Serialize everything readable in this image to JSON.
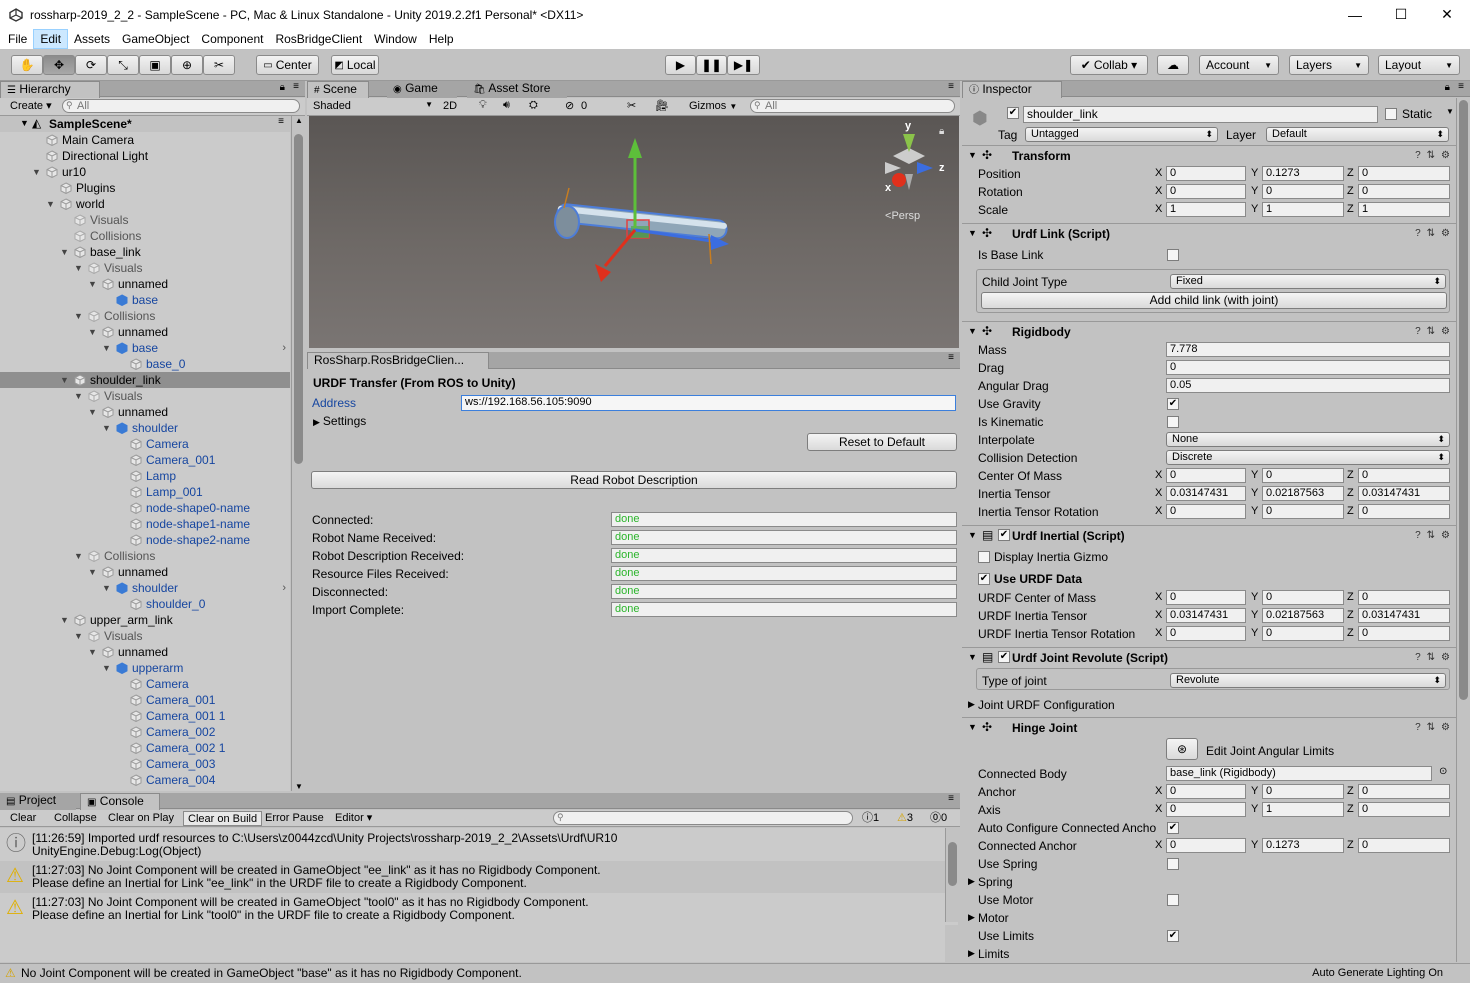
{
  "window": {
    "title": "rossharp-2019_2_2 - SampleScene - PC, Mac & Linux Standalone - Unity 2019.2.2f1 Personal* <DX11>",
    "minimize": "—",
    "maximize": "☐",
    "close": "✕"
  },
  "menu": [
    "File",
    "Edit",
    "Assets",
    "GameObject",
    "Component",
    "RosBridgeClient",
    "Window",
    "Help"
  ],
  "toolbar": {
    "center": "Center",
    "local": "Local",
    "collab": "Collab ▾",
    "account": "Account",
    "layers": "Layers",
    "layout": "Layout"
  },
  "hierarchy": {
    "tab": "Hierarchy",
    "create": "Create ▾",
    "search_placeholder": "All",
    "scene": "SampleScene*",
    "items": [
      {
        "label": "Main Camera",
        "style": "normal"
      },
      {
        "label": "Directional Light",
        "style": "normal"
      },
      {
        "label": "ur10",
        "style": "normal"
      },
      {
        "label": "Plugins",
        "style": "normal"
      },
      {
        "label": "world",
        "style": "normal"
      },
      {
        "label": "Visuals",
        "style": "gray"
      },
      {
        "label": "Collisions",
        "style": "gray"
      },
      {
        "label": "base_link",
        "style": "normal"
      },
      {
        "label": "Visuals",
        "style": "gray"
      },
      {
        "label": "unnamed",
        "style": "normal"
      },
      {
        "label": "base",
        "style": "blue"
      },
      {
        "label": "Collisions",
        "style": "gray"
      },
      {
        "label": "unnamed",
        "style": "normal"
      },
      {
        "label": "base",
        "style": "blue"
      },
      {
        "label": "base_0",
        "style": "blue"
      },
      {
        "label": "shoulder_link",
        "style": "normal"
      },
      {
        "label": "Visuals",
        "style": "gray"
      },
      {
        "label": "unnamed",
        "style": "normal"
      },
      {
        "label": "shoulder",
        "style": "blue"
      },
      {
        "label": "Camera",
        "style": "blue"
      },
      {
        "label": "Camera_001",
        "style": "blue"
      },
      {
        "label": "Lamp",
        "style": "blue"
      },
      {
        "label": "Lamp_001",
        "style": "blue"
      },
      {
        "label": "node-shape0-name",
        "style": "blue"
      },
      {
        "label": "node-shape1-name",
        "style": "blue"
      },
      {
        "label": "node-shape2-name",
        "style": "blue"
      },
      {
        "label": "Collisions",
        "style": "gray"
      },
      {
        "label": "unnamed",
        "style": "normal"
      },
      {
        "label": "shoulder",
        "style": "blue"
      },
      {
        "label": "shoulder_0",
        "style": "blue"
      },
      {
        "label": "upper_arm_link",
        "style": "normal"
      },
      {
        "label": "Visuals",
        "style": "gray"
      },
      {
        "label": "unnamed",
        "style": "normal"
      },
      {
        "label": "upperarm",
        "style": "blue"
      },
      {
        "label": "Camera",
        "style": "blue"
      },
      {
        "label": "Camera_001",
        "style": "blue"
      },
      {
        "label": "Camera_001 1",
        "style": "blue"
      },
      {
        "label": "Camera_002",
        "style": "blue"
      },
      {
        "label": "Camera_002 1",
        "style": "blue"
      },
      {
        "label": "Camera_003",
        "style": "blue"
      },
      {
        "label": "Camera_004",
        "style": "blue"
      }
    ]
  },
  "scene_tabs": {
    "scene": "Scene",
    "game": "Game",
    "asset_store": "Asset Store"
  },
  "scene_bar": {
    "shading": "Shaded",
    "two_d": "2D",
    "hidden_count": "0",
    "gizmos": "Gizmos",
    "search_placeholder": "All",
    "persp": "Persp",
    "axis_x": "x",
    "axis_y": "y",
    "axis_z": "z"
  },
  "ros": {
    "tab": "RosSharp.RosBridgeClien...",
    "title": "URDF Transfer (From ROS to Unity)",
    "address_label": "Address",
    "address_value": "ws://192.168.56.105:9090",
    "settings": "Settings",
    "reset": "Reset to Default",
    "read": "Read Robot Description",
    "status": [
      {
        "label": "Connected:",
        "value": "done"
      },
      {
        "label": "Robot Name Received:",
        "value": "done"
      },
      {
        "label": "Robot Description Received:",
        "value": "done"
      },
      {
        "label": "Resource Files Received:",
        "value": "done"
      },
      {
        "label": "Disconnected:",
        "value": "done"
      },
      {
        "label": "Import Complete:",
        "value": "done"
      }
    ]
  },
  "console": {
    "tabs": {
      "project": "Project",
      "console": "Console"
    },
    "buttons": {
      "clear": "Clear",
      "collapse": "Collapse",
      "clear_on_play": "Clear on Play",
      "clear_on_build": "Clear on Build",
      "error_pause": "Error Pause",
      "editor": "Editor ▾"
    },
    "counts": {
      "info": "1",
      "warn": "3",
      "error": "0"
    },
    "messages": [
      {
        "type": "info",
        "line1": "[11:26:59] Imported urdf resources to C:\\Users\\z0044zcd\\Unity Projects\\rossharp-2019_2_2\\Assets\\Urdf\\UR10",
        "line2": "UnityEngine.Debug:Log(Object)"
      },
      {
        "type": "warn",
        "line1": "[11:27:03] No Joint Component will be created in GameObject \"ee_link\" as it has no Rigidbody Component.",
        "line2": "Please define an Inertial for Link \"ee_link\" in the URDF file to create a Rigidbody Component."
      },
      {
        "type": "warn",
        "line1": "[11:27:03] No Joint Component will be created in GameObject \"tool0\" as it has no Rigidbody Component.",
        "line2": "Please define an Inertial for Link \"tool0\" in the URDF file to create a Rigidbody Component."
      }
    ]
  },
  "inspector": {
    "tab": "Inspector",
    "name": "shoulder_link",
    "static": "Static",
    "tag_label": "Tag",
    "tag": "Untagged",
    "layer_label": "Layer",
    "layer": "Default",
    "transform": {
      "title": "Transform",
      "position": {
        "label": "Position",
        "x": "0",
        "y": "0.1273",
        "z": "0"
      },
      "rotation": {
        "label": "Rotation",
        "x": "0",
        "y": "0",
        "z": "0"
      },
      "scale": {
        "label": "Scale",
        "x": "1",
        "y": "1",
        "z": "1"
      }
    },
    "urdf_link": {
      "title": "Urdf Link (Script)",
      "is_base": "Is Base Link",
      "child_joint_label": "Child Joint Type",
      "child_joint": "Fixed",
      "add_child": "Add child link (with joint)"
    },
    "rigidbody": {
      "title": "Rigidbody",
      "mass_label": "Mass",
      "mass": "7.778",
      "drag_label": "Drag",
      "drag": "0",
      "angular_drag_label": "Angular Drag",
      "angular_drag": "0.05",
      "use_gravity": "Use Gravity",
      "is_kinematic": "Is Kinematic",
      "interpolate_label": "Interpolate",
      "interpolate": "None",
      "collision_label": "Collision Detection",
      "collision": "Discrete",
      "com": {
        "label": "Center Of Mass",
        "x": "0",
        "y": "0",
        "z": "0"
      },
      "inertia": {
        "label": "Inertia Tensor",
        "x": "0.03147431",
        "y": "0.02187563",
        "z": "0.03147431"
      },
      "inertia_rot": {
        "label": "Inertia Tensor Rotation",
        "x": "0",
        "y": "0",
        "z": "0"
      }
    },
    "urdf_inertial": {
      "title": "Urdf Inertial (Script)",
      "display_gizmo": "Display Inertia Gizmo",
      "use_urdf": "Use URDF Data",
      "com": {
        "label": "URDF Center of Mass",
        "x": "0",
        "y": "0",
        "z": "0"
      },
      "inertia": {
        "label": "URDF Inertia Tensor",
        "x": "0.03147431",
        "y": "0.02187563",
        "z": "0.03147431"
      },
      "inertia_rot": {
        "label": "URDF Inertia Tensor Rotation",
        "x": "0",
        "y": "0",
        "z": "0"
      }
    },
    "joint_revolute": {
      "title": "Urdf Joint Revolute (Script)",
      "type_label": "Type of joint",
      "type": "Revolute",
      "config": "Joint URDF Configuration"
    },
    "hinge": {
      "title": "Hinge Joint",
      "edit_limits": "Edit Joint Angular Limits",
      "connected_label": "Connected Body",
      "connected": "base_link (Rigidbody)",
      "anchor": {
        "label": "Anchor",
        "x": "0",
        "y": "0",
        "z": "0"
      },
      "axis": {
        "label": "Axis",
        "x": "0",
        "y": "1",
        "z": "0"
      },
      "auto_configure": "Auto Configure Connected Ancho",
      "connected_anchor": {
        "label": "Connected Anchor",
        "x": "0",
        "y": "0.1273",
        "z": "0"
      },
      "use_spring": "Use Spring",
      "spring": "Spring",
      "use_motor": "Use Motor",
      "motor": "Motor",
      "use_limits": "Use Limits",
      "limits": "Limits"
    }
  },
  "status": {
    "message": "No Joint Component will be created in GameObject \"base\" as it has no Rigidbody Component.",
    "right": "Auto Generate Lighting On"
  },
  "xyz_labels": {
    "x": "X",
    "y": "Y",
    "z": "Z"
  }
}
